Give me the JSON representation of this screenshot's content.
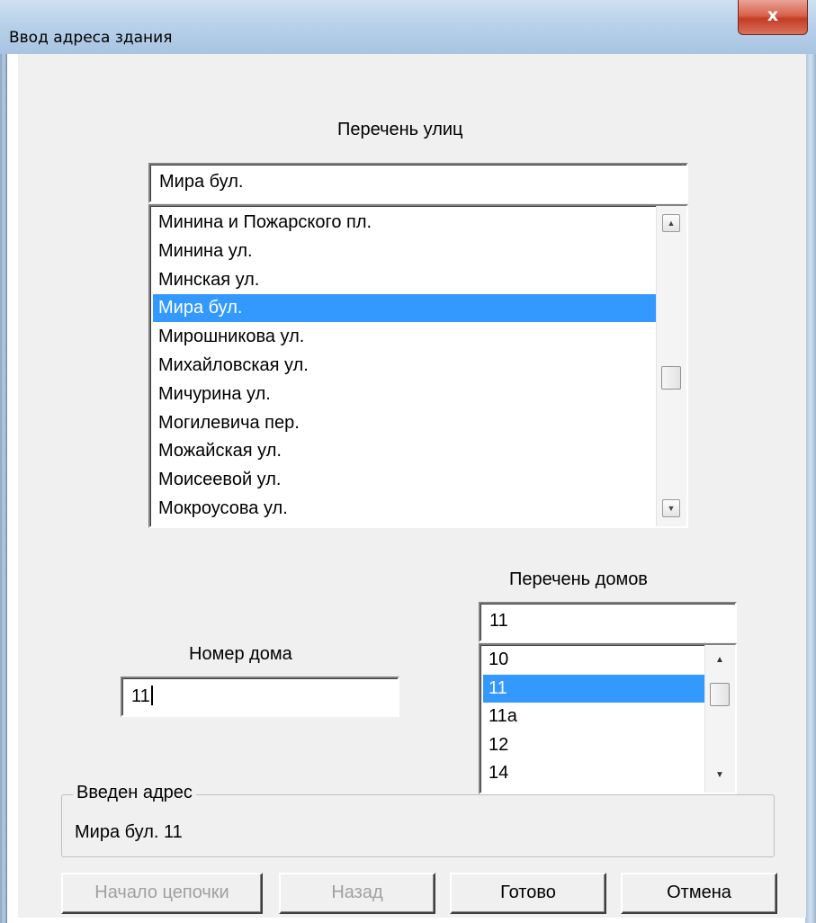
{
  "window": {
    "title": "Ввод адреса здания",
    "close_glyph": "x"
  },
  "streets": {
    "label": "Перечень улиц",
    "input_value": "Мира бул.",
    "items": [
      "Минина и Пожарского пл.",
      "Минина ул.",
      "Минская ул.",
      "Мира бул.",
      "Мирошникова ул.",
      "Михайловская ул.",
      "Мичурина ул.",
      "Могилевича пер.",
      "Можайская ул.",
      "Моисеевой ул.",
      "Мокроусова ул."
    ],
    "selected_index": 3
  },
  "houses": {
    "label": "Перечень  домов",
    "input_value": "11",
    "items": [
      "10",
      "11",
      "11а",
      "12",
      "14"
    ],
    "selected_index": 1
  },
  "house_number": {
    "label": "Номер дома",
    "input_value": "11"
  },
  "entered_address": {
    "legend": "Введен  адрес",
    "value": "Мира бул. 11"
  },
  "buttons": {
    "chain_start": "Начало цепочки",
    "back": "Назад",
    "done": "Готово",
    "cancel": "Отмена"
  },
  "icons": {
    "scroll_up": "▲",
    "scroll_down": "▼"
  },
  "colors": {
    "selection": "#3399ff",
    "close_button": "#c43c24",
    "dialog_bg": "#f0f0f0"
  }
}
